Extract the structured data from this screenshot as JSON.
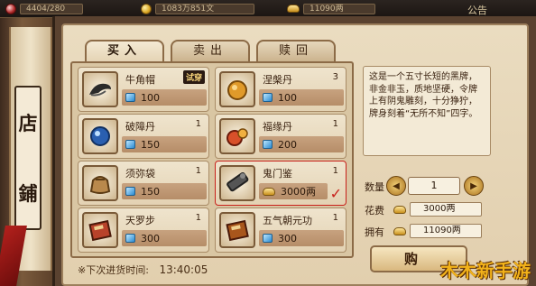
{
  "topbar": {
    "left_value": "4404/280",
    "mid_value": "1083万851文",
    "right_value": "11090两",
    "announce": "公告"
  },
  "shop": {
    "sign_chars": [
      "店",
      "鋪"
    ],
    "tabs": [
      {
        "label": "买入",
        "active": true
      },
      {
        "label": "卖出",
        "active": false
      },
      {
        "label": "赎回",
        "active": false
      }
    ],
    "items": [
      {
        "name": "牛角帽",
        "qty": "",
        "price": "100",
        "currency": "gem",
        "badge": "试穿",
        "selected": false
      },
      {
        "name": "涅槃丹",
        "qty": "3",
        "price": "100",
        "currency": "gem",
        "badge": "",
        "selected": false
      },
      {
        "name": "破障丹",
        "qty": "1",
        "price": "150",
        "currency": "gem",
        "badge": "",
        "selected": false
      },
      {
        "name": "福缘丹",
        "qty": "1",
        "price": "200",
        "currency": "gem",
        "badge": "",
        "selected": false
      },
      {
        "name": "须弥袋",
        "qty": "1",
        "price": "150",
        "currency": "gem",
        "badge": "",
        "selected": false
      },
      {
        "name": "鬼门鉴",
        "qty": "1",
        "price": "3000两",
        "currency": "ingot",
        "badge": "",
        "selected": true
      },
      {
        "name": "天罗步",
        "qty": "1",
        "price": "300",
        "currency": "gem",
        "badge": "",
        "selected": false
      },
      {
        "name": "五气朝元功",
        "qty": "1",
        "price": "300",
        "currency": "gem",
        "badge": "",
        "selected": false
      }
    ],
    "restock_label": "※下次进货时间:",
    "restock_time": "13:40:05"
  },
  "detail": {
    "description": "这是一个五寸长短的黑牌，非金非玉，质地坚硬，令牌上有阴鬼雕刻，十分狰狞，牌身刻着“无所不知”四字。",
    "qty_label": "数量",
    "qty_value": "1",
    "cost_label": "花费",
    "cost_value": "3000两",
    "own_label": "拥有",
    "own_value": "11090两",
    "buy_label": "购"
  },
  "watermark": "木木新手游"
}
